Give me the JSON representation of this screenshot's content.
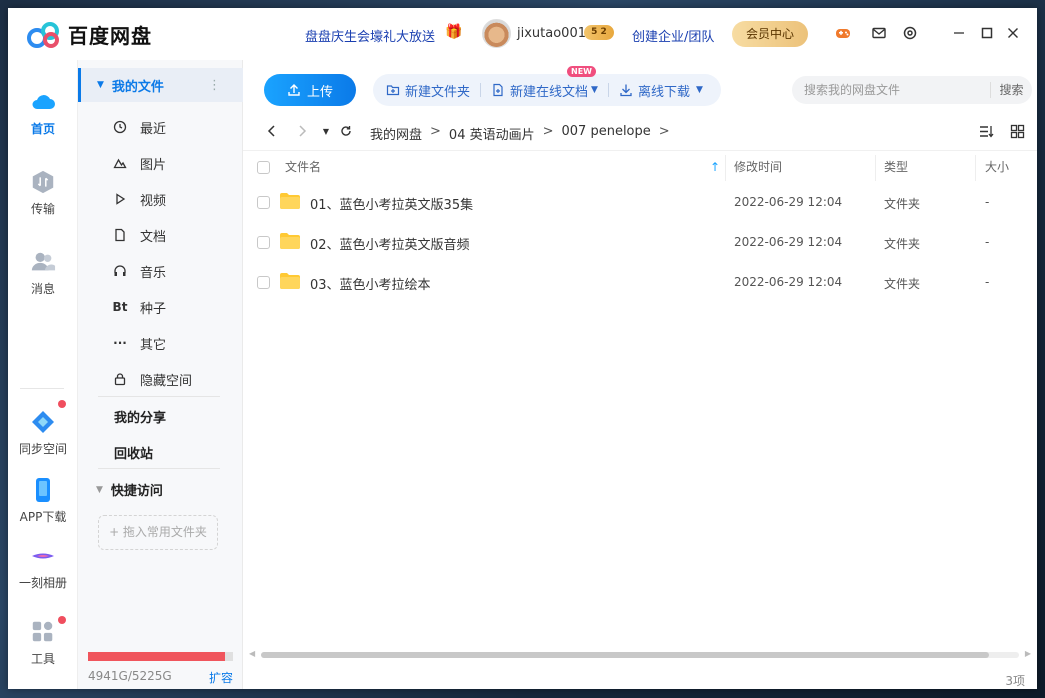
{
  "app": {
    "title": "百度网盘"
  },
  "header": {
    "promo": "盘盘庆生会壕礼大放送",
    "username": "jixutao001",
    "vip_level": "5 2",
    "enterprise": "创建企业/团队",
    "vip_center": "会员中心"
  },
  "rail": {
    "home": "首页",
    "transfer": "传输",
    "messages": "消息",
    "sync": "同步空间",
    "app_download": "APP下载",
    "album": "一刻相册",
    "tools": "工具"
  },
  "sidebar": {
    "my_files": "我的文件",
    "items": [
      {
        "label": "最近",
        "icon": "clock-icon"
      },
      {
        "label": "图片",
        "icon": "image-icon"
      },
      {
        "label": "视频",
        "icon": "play-icon"
      },
      {
        "label": "文档",
        "icon": "document-icon"
      },
      {
        "label": "音乐",
        "icon": "headphones-icon"
      },
      {
        "label": "种子",
        "icon": "bt-icon",
        "glyph": "Bt"
      },
      {
        "label": "其它",
        "icon": "more-icon",
        "glyph": "···"
      },
      {
        "label": "隐藏空间",
        "icon": "lock-icon"
      }
    ],
    "my_share": "我的分享",
    "recycle": "回收站",
    "quick_access": "快捷访问",
    "drop_hint": "+ 拖入常用文件夹",
    "quota_text": "4941G/5225G",
    "quota_fraction": 0.9457,
    "expand": "扩容"
  },
  "toolbar": {
    "upload": "上传",
    "new_folder": "新建文件夹",
    "new_online_doc": "新建在线文档",
    "new_badge": "NEW",
    "offline_download": "离线下载",
    "search_placeholder": "搜索我的网盘文件",
    "search_button": "搜索"
  },
  "breadcrumb": {
    "items": [
      "我的网盘",
      "04 英语动画片",
      "007 penelope"
    ],
    "separator": ">"
  },
  "table": {
    "columns": {
      "name": "文件名",
      "modified": "修改时间",
      "type": "类型",
      "size": "大小"
    },
    "rows": [
      {
        "name": "01、蓝色小考拉英文版35集",
        "modified": "2022-06-29 12:04",
        "type": "文件夹",
        "size": "-"
      },
      {
        "name": "02、蓝色小考拉英文版音频",
        "modified": "2022-06-29 12:04",
        "type": "文件夹",
        "size": "-"
      },
      {
        "name": "03、蓝色小考拉绘本",
        "modified": "2022-06-29 12:04",
        "type": "文件夹",
        "size": "-"
      }
    ]
  },
  "status": {
    "count": "3项"
  },
  "colors": {
    "accent": "#0b7ae8",
    "folder": "#ffc933",
    "quota": "#f0555c",
    "dot": "#f04e5e"
  }
}
